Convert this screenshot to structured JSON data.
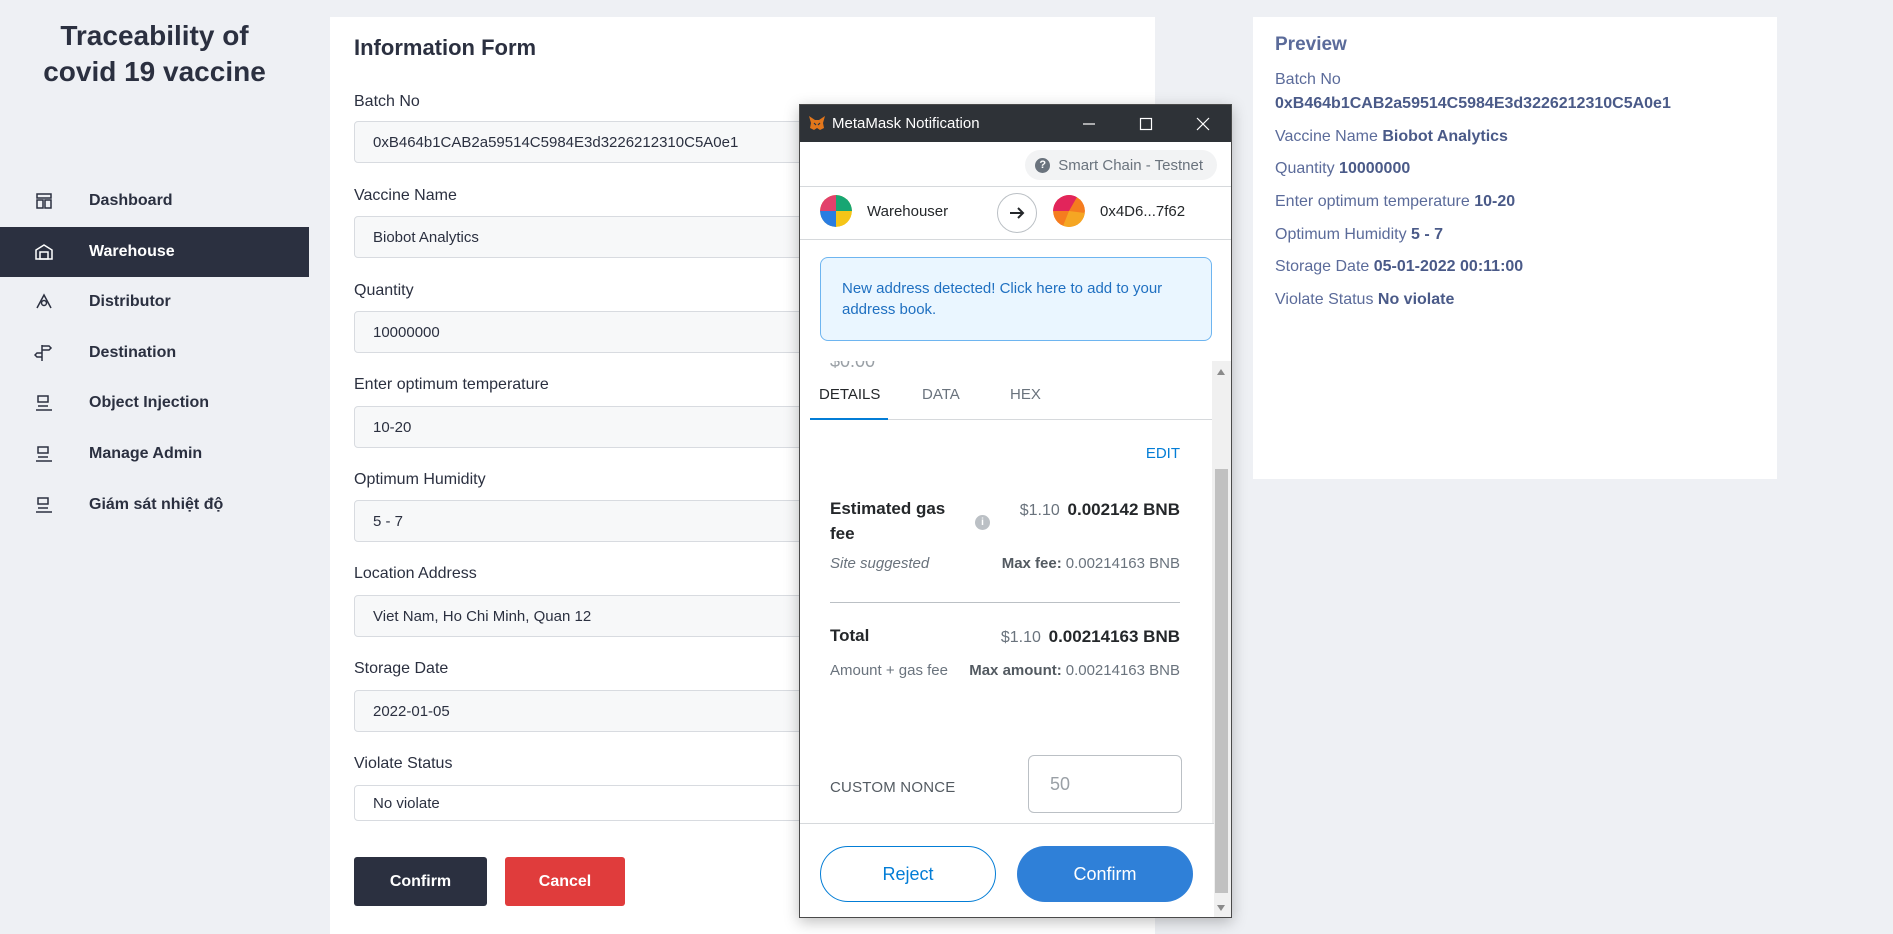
{
  "sidebar": {
    "brand_line1": "Traceability of",
    "brand_line2": "covid 19 vaccine",
    "items": [
      {
        "label": "Dashboard",
        "icon": "dashboard-icon",
        "active": false
      },
      {
        "label": "Warehouse",
        "icon": "warehouse-icon",
        "active": true
      },
      {
        "label": "Distributor",
        "icon": "distributor-icon",
        "active": false
      },
      {
        "label": "Destination",
        "icon": "destination-icon",
        "active": false
      },
      {
        "label": "Object Injection",
        "icon": "injection-icon",
        "active": false
      },
      {
        "label": "Manage Admin",
        "icon": "admin-icon",
        "active": false
      },
      {
        "label": "Giám sát nhiệt độ",
        "icon": "temperature-icon",
        "active": false
      }
    ]
  },
  "form": {
    "title": "Information Form",
    "fields": [
      {
        "label": "Batch No",
        "value": "0xB464b1CAB2a59514C5984E3d3226212310C5A0e1"
      },
      {
        "label": "Vaccine Name",
        "value": "Biobot Analytics"
      },
      {
        "label": "Quantity",
        "value": "10000000"
      },
      {
        "label": "Enter optimum temperature",
        "value": "10-20"
      },
      {
        "label": "Optimum Humidity",
        "value": "5 - 7"
      },
      {
        "label": "Location Address",
        "value": "Viet Nam, Ho Chi Minh, Quan 12"
      },
      {
        "label": "Storage Date",
        "value": "2022-01-05"
      },
      {
        "label": "Violate Status",
        "value": "No violate"
      }
    ],
    "confirm_label": "Confirm",
    "cancel_label": "Cancel"
  },
  "preview": {
    "title": "Preview",
    "batch_label": "Batch No",
    "batch_value": "0xB464b1CAB2a59514C5984E3d3226212310C5A0e1",
    "vaccine_label": "Vaccine Name",
    "vaccine_value": "Biobot Analytics",
    "quantity_label": "Quantity",
    "quantity_value": "10000000",
    "temp_label": "Enter optimum temperature",
    "temp_value": "10-20",
    "humidity_label": "Optimum Humidity",
    "humidity_value": "5 - 7",
    "storage_label": "Storage Date",
    "storage_value": "05-01-2022 00:11:00",
    "violate_label": "Violate Status",
    "violate_value": "No violate"
  },
  "metamask": {
    "window_title": "MetaMask Notification",
    "network": "Smart Chain - Testnet",
    "network_help": "?",
    "from_account": "Warehouser",
    "to_account": "0x4D6...7f62",
    "notice": "New address detected! Click here to add to your address book.",
    "ghost_value": "$0.00",
    "tabs": [
      "DETAILS",
      "DATA",
      "HEX"
    ],
    "edit_label": "EDIT",
    "gas_label": "Estimated gas fee",
    "gas_fiat": "$1.10",
    "gas_amount": "0.002142 BNB",
    "site_suggested": "Site suggested",
    "max_fee_label": "Max fee:",
    "max_fee_value": "0.00214163 BNB",
    "total_label": "Total",
    "total_fiat": "$1.10",
    "total_amount": "0.00214163 BNB",
    "amount_gas_label": "Amount + gas fee",
    "max_amount_label": "Max amount:",
    "max_amount_value": "0.00214163 BNB",
    "nonce_label": "CUSTOM NONCE",
    "nonce_placeholder": "50",
    "info_glyph": "i",
    "reject_label": "Reject",
    "confirm_label": "Confirm"
  },
  "colors": {
    "sidebar_active": "#2b3040",
    "cancel_red": "#e03c3c",
    "mm_blue": "#037dd6",
    "mm_confirm": "#2f80d8",
    "preview_text": "#5b6b9a"
  }
}
